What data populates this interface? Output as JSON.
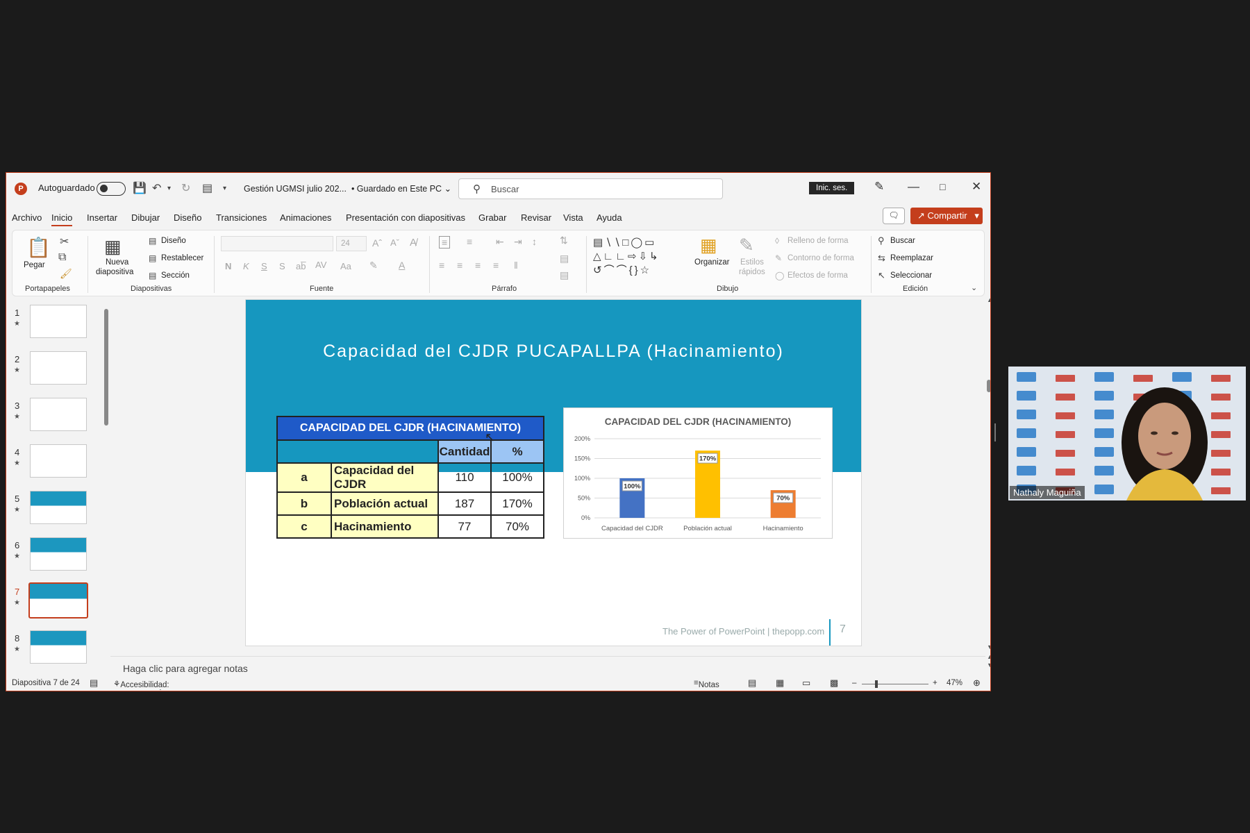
{
  "titlebar": {
    "autosave_label": "Autoguardado",
    "doc_title": "Gestión UGMSI julio 202...",
    "save_state": "• Guardado en Este PC",
    "search_placeholder": "Buscar",
    "signin_label": "Inic. ses."
  },
  "menu": {
    "items": [
      "Archivo",
      "Inicio",
      "Insertar",
      "Dibujar",
      "Diseño",
      "Transiciones",
      "Animaciones",
      "Presentación con diapositivas",
      "Grabar",
      "Revisar",
      "Vista",
      "Ayuda"
    ],
    "share_label": "Compartir"
  },
  "ribbon": {
    "portapapeles": {
      "paste": "Pegar",
      "group": "Portapapeles"
    },
    "diapositivas": {
      "new": "Nueva",
      "new2": "diapositiva",
      "layout": "Diseño",
      "reset": "Restablecer",
      "section": "Sección",
      "group": "Diapositivas"
    },
    "fuente": {
      "size": "24",
      "bold": "N",
      "italic": "K",
      "underline": "S",
      "shadow": "S",
      "case": "Aa",
      "group": "Fuente"
    },
    "parrafo": {
      "group": "Párrafo"
    },
    "dibujo": {
      "organize": "Organizar",
      "quick": "Estilos",
      "quick2": "rápidos",
      "fill": "Relleno de forma",
      "outline": "Contorno de forma",
      "effects": "Efectos de forma",
      "group": "Dibujo"
    },
    "edicion": {
      "find": "Buscar",
      "replace": "Reemplazar",
      "select": "Seleccionar",
      "group": "Edición"
    }
  },
  "thumbnails": [
    {
      "num": "1",
      "style": "white"
    },
    {
      "num": "2",
      "style": "white"
    },
    {
      "num": "3",
      "style": "white"
    },
    {
      "num": "4",
      "style": "white"
    },
    {
      "num": "5",
      "style": "blue"
    },
    {
      "num": "6",
      "style": "blue"
    },
    {
      "num": "7",
      "style": "blue",
      "selected": true
    },
    {
      "num": "8",
      "style": "blue"
    }
  ],
  "slide": {
    "title": "Capacidad del CJDR PUCAPALLPA (Hacinamiento)",
    "footer": "The Power of PowerPoint | thepopp.com",
    "page": "7",
    "table": {
      "header": "CAPACIDAD DEL CJDR (HACINAMIENTO)",
      "col_qty": "Cantidad",
      "col_pct": "%",
      "rows": [
        {
          "key": "a",
          "label": "Capacidad del CJDR",
          "qty": "110",
          "pct": "100%"
        },
        {
          "key": "b",
          "label": "Población actual",
          "qty": "187",
          "pct": "170%"
        },
        {
          "key": "c",
          "label": "Hacinamiento",
          "qty": "77",
          "pct": "70%"
        }
      ]
    }
  },
  "chart_data": {
    "type": "bar",
    "title": "CAPACIDAD DEL CJDR (HACINAMIENTO)",
    "categories": [
      "Capacidad del CJDR",
      "Población actual",
      "Hacinamiento"
    ],
    "values": [
      100,
      170,
      70
    ],
    "data_labels": [
      "100%",
      "170%",
      "70%"
    ],
    "colors": [
      "#4472c4",
      "#ffc000",
      "#ed7d31"
    ],
    "yticks": [
      "0%",
      "50%",
      "100%",
      "150%",
      "200%"
    ],
    "ylim": [
      0,
      200
    ],
    "grid": true
  },
  "notes_placeholder": "Haga clic para agregar notas",
  "status": {
    "slide_info": "Diapositiva 7 de 24",
    "accessibility": "Accesibilidad: es necesario investigar",
    "notes": "Notas",
    "zoom": "47%"
  },
  "video": {
    "participant": "Nathaly Maguiña"
  }
}
